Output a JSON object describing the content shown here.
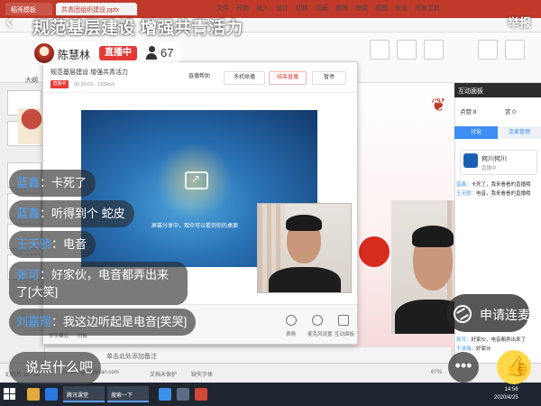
{
  "overlay": {
    "title": "规范基层建设 增强共青活力",
    "report_label": "举报",
    "host_name": "陈慧林",
    "live_badge": "直播中",
    "viewer_count": "67",
    "say_placeholder": "说点什么吧",
    "connect_label": "申请连麦",
    "more_label": "•••",
    "chat": [
      {
        "name": "蓝鑫",
        "text": "卡死了"
      },
      {
        "name": "蓝鑫",
        "text": "听得到个 蛇皮"
      },
      {
        "name": "王天骄",
        "text": "电音"
      },
      {
        "name": "张可",
        "text": "好家伙，电音都弄出来了[大笑]"
      },
      {
        "name": "刘嘉翔",
        "text": "我这边听起是电音[笑哭]"
      }
    ]
  },
  "app": {
    "tabs": [
      "稻壳模板",
      "共青团组织建设.pptx"
    ],
    "ribbon_tabs": [
      "文件",
      "开始",
      "插入",
      "设计",
      "切换",
      "动画",
      "放映",
      "审阅",
      "视图",
      "安全",
      "开发工具",
      "特色功能"
    ],
    "thumb_header": "大纲",
    "notes_placeholder": "单击此处添加备注",
    "status": {
      "slide_info": "幻灯片 18 / 30",
      "site": "www.longjingjiyuan.com",
      "beautify": "文档未保护",
      "font_missing": "缺失字体",
      "zoom": "67%"
    },
    "taskbar": {
      "items": [
        "腾讯课堂",
        "搜索一下"
      ],
      "time": "14:56",
      "date": "2020/4/25"
    }
  },
  "live_window": {
    "title": "规范基层建设 增强共青活力",
    "badge": "直播中",
    "stats": "00:25:06 · 153kb/s",
    "buttons": {
      "help": "直播帮助",
      "multi_cam": "多机联播",
      "end": "结束直播",
      "pause": "暂停"
    },
    "share_caption": "屏幕分享中，观众可以看到你的桌面",
    "footer_left": [
      "举手模式",
      "白板"
    ],
    "footer_tools": [
      "表情",
      "麦克风设置",
      "互动面板"
    ]
  },
  "panel": {
    "title": "互动面板",
    "likes": "点赞 8",
    "gifts": "赏 0",
    "tab_active": "讨论",
    "tab_inactive": "连麦管理",
    "card_name": "何川何川",
    "card_role": "直播中",
    "messages": [
      {
        "name": "蓝鑫：",
        "text": "卡死了，我来看看的直播哦"
      },
      {
        "name": "王天骄：",
        "text": "电音，我来看看的直播哦"
      },
      {
        "name": "张可：",
        "text": "好家伙，电音都弄出来了"
      },
      {
        "name": "于泽瑞：",
        "text": "好家伙"
      },
      {
        "name": "刘嘉翔：",
        "text": "我这边听起是电音"
      }
    ]
  },
  "colors": {
    "accent_red": "#e53935",
    "chat_name_blue": "#4aa3ff",
    "panel_blue": "#3f8ef3",
    "like_yellow": "#ffd84a"
  }
}
